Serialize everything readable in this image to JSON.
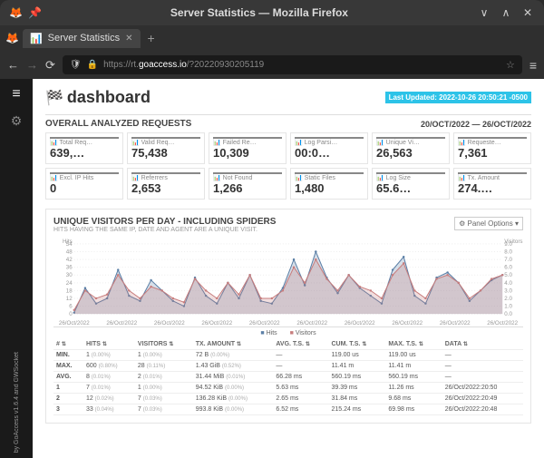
{
  "window": {
    "title": "Server Statistics — Mozilla Firefox"
  },
  "tab": {
    "label": "Server Statistics"
  },
  "url": {
    "prefix": "https://rt.",
    "domain": "goaccess.io",
    "path": "/?20220930205119"
  },
  "dashboard": {
    "title": "dashboard",
    "last_updated": "Last Updated: 2022-10-26 20:50:21 -0500"
  },
  "overall": {
    "label": "OVERALL ANALYZED REQUESTS",
    "range": "20/OCT/2022 — 26/OCT/2022"
  },
  "cards": [
    {
      "label": "Total Req…",
      "value": "639,…",
      "c": "bc0"
    },
    {
      "label": "Valid Req…",
      "value": "75,438",
      "c": "bc1"
    },
    {
      "label": "Failed Re…",
      "value": "10,309",
      "c": "bc2"
    },
    {
      "label": "Log Parsi…",
      "value": "00:0…",
      "c": "bc3"
    },
    {
      "label": "Unique Vi…",
      "value": "26,563",
      "c": "bc4"
    },
    {
      "label": "Requeste…",
      "value": "7,361",
      "c": "bc5"
    },
    {
      "label": "Excl. IP Hits",
      "value": "0",
      "c": "bc0"
    },
    {
      "label": "Referrers",
      "value": "2,653",
      "c": "bc0"
    },
    {
      "label": "Not Found",
      "value": "1,266",
      "c": "bc0"
    },
    {
      "label": "Static Files",
      "value": "1,480",
      "c": "bc0"
    },
    {
      "label": "Log Size",
      "value": "65.6…",
      "c": "bc0"
    },
    {
      "label": "Tx. Amount",
      "value": "274.…",
      "c": "bc0"
    }
  ],
  "panel": {
    "title": "UNIQUE VISITORS PER DAY - INCLUDING SPIDERS",
    "subtitle": "HITS HAVING THE SAME IP, DATE AND AGENT ARE A UNIQUE VISIT.",
    "options": "Panel Options",
    "legend": {
      "hits": "Hits",
      "visitors": "Visitors"
    },
    "ylabel_left": "Hits",
    "ylabel_right": "Visitors"
  },
  "chart_data": {
    "type": "line",
    "ylabel_left": "Hits",
    "ylabel_right": "Visitors",
    "ylim_left": [
      0,
      54
    ],
    "yticks_left": [
      0,
      6,
      12,
      18,
      24,
      30,
      36,
      42,
      48,
      54
    ],
    "ylim_right": [
      0,
      9.0
    ],
    "yticks_right": [
      0.0,
      1.0,
      2.0,
      3.0,
      4.0,
      5.0,
      6.0,
      7.0,
      8.0,
      9.0
    ],
    "x_labels": [
      "26/Oct/2022",
      "26/Oct/2022",
      "26/Oct/2022",
      "26/Oct/2022",
      "26/Oct/2022",
      "26/Oct/2022",
      "26/Oct/2022",
      "26/Oct/2022",
      "26/Oct/2022",
      "26/Oct/2022"
    ],
    "series": [
      {
        "name": "Hits",
        "color": "#5b7fa6",
        "values": [
          1,
          20,
          8,
          12,
          34,
          14,
          10,
          26,
          18,
          10,
          6,
          28,
          14,
          8,
          24,
          12,
          30,
          10,
          8,
          20,
          42,
          22,
          48,
          28,
          16,
          30,
          20,
          14,
          8,
          34,
          44,
          14,
          8,
          28,
          32,
          24,
          10,
          18,
          26,
          30
        ]
      },
      {
        "name": "Visitors",
        "color": "#c77c7c",
        "values": [
          0.5,
          3,
          2,
          2.5,
          5,
          3,
          2,
          3.5,
          3,
          2,
          1.5,
          4.5,
          3,
          2,
          4,
          2.5,
          5,
          2,
          2,
          3,
          6,
          4,
          7,
          4.5,
          3,
          5,
          3.5,
          3,
          2,
          5,
          6.5,
          3,
          2,
          4.5,
          5,
          4,
          2,
          3,
          4.5,
          5
        ]
      }
    ]
  },
  "table": {
    "headers": [
      "#",
      "HITS",
      "VISITORS",
      "TX. AMOUNT",
      "AVG. T.S.",
      "CUM. T.S.",
      "MAX. T.S.",
      "DATA"
    ],
    "rows": [
      {
        "id": "MIN.",
        "hits": "1",
        "hp": "(0.00%)",
        "vis": "1",
        "vp": "(0.00%)",
        "tx": "72 B",
        "txp": "(0.00%)",
        "avg": "—",
        "cum": "119.00 us",
        "max": "119.00 us",
        "data": "—"
      },
      {
        "id": "MAX.",
        "hits": "600",
        "hp": "(0.80%)",
        "vis": "28",
        "vp": "(0.11%)",
        "tx": "1.43 GiB",
        "txp": "(0.52%)",
        "avg": "—",
        "cum": "11.41 m",
        "max": "11.41 m",
        "data": "—"
      },
      {
        "id": "AVG.",
        "hits": "8",
        "hp": "(0.01%)",
        "vis": "2",
        "vp": "(0.01%)",
        "tx": "31.44 MiB",
        "txp": "(0.01%)",
        "avg": "66.28 ms",
        "cum": "560.19 ms",
        "max": "560.19 ms",
        "data": "—"
      },
      {
        "id": "1",
        "hits": "7",
        "hp": "(0.01%)",
        "vis": "1",
        "vp": "(0.00%)",
        "tx": "94.52 KiB",
        "txp": "(0.00%)",
        "avg": "5.63 ms",
        "cum": "39.39 ms",
        "max": "11.26 ms",
        "data": "26/Oct/2022:20:50"
      },
      {
        "id": "2",
        "hits": "12",
        "hp": "(0.02%)",
        "vis": "7",
        "vp": "(0.03%)",
        "tx": "136.28 KiB",
        "txp": "(0.00%)",
        "avg": "2.65 ms",
        "cum": "31.84 ms",
        "max": "9.68 ms",
        "data": "26/Oct/2022:20:49"
      },
      {
        "id": "3",
        "hits": "33",
        "hp": "(0.04%)",
        "vis": "7",
        "vp": "(0.03%)",
        "tx": "993.8 KiB",
        "txp": "(0.00%)",
        "avg": "6.52 ms",
        "cum": "215.24 ms",
        "max": "69.98 ms",
        "data": "26/Oct/2022:20:48"
      }
    ]
  },
  "credit": "by GoAccess v1.6.4 and GWSocket"
}
